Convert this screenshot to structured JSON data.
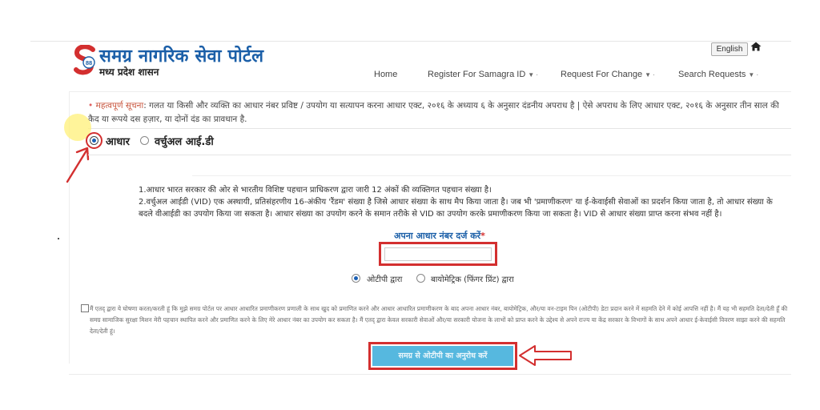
{
  "brand": {
    "title": "समग्र नागरिक सेवा पोर्टल",
    "subtitle": "मध्य प्रदेश शासन",
    "logo_badge": "88"
  },
  "header": {
    "language_button": "English",
    "home_icon": "home-icon"
  },
  "nav": {
    "home": "Home",
    "register": "Register For Samagra ID",
    "request": "Request For Change",
    "search": "Search Requests",
    "dropdown_icon": "caret-down-icon"
  },
  "notice": {
    "bullet": "•",
    "label": "महत्वपूर्ण सूचना",
    "text": ": गलत या किसी और व्यक्ति का आधार नंबर प्रविष्ट / उपयोग या सत्यापन करना आधार एक्ट, २०१६ के अध्याय ६ के अनुसार दंडनीय अपराध है | ऐसे अपराध के लिए आधार एक्ट, २०१६ के अनुसार तीन साल की कैद या रूपये दस हज़ार, या दोनों दंड का प्रावधान है."
  },
  "id_type": {
    "aadhaar": "आधार",
    "vid": "वर्चुअल आई.डी",
    "selected": "aadhaar"
  },
  "info": {
    "line1": "1.आधार भारत सरकार की ओर से भारतीय विशिष्ट पहचान प्राधिकरण द्वारा जारी 12 अंकों की व्यक्तिगत पहचान संख्या है।",
    "line2": "2.वर्चुअल आईडी (VID) एक अस्थायी, प्रतिसंहरणीय 16-अंकीय 'रैंडम' संख्या है जिसे आधार संख्या के साथ मैप किया जाता है। जब भी 'प्रमाणीकरण' या ई-केवाईसी सेवाओं का प्रदर्शन किया जाता है, तो आधार संख्या के बदले वीआईडी का उपयोग किया जा सकता है। आधार संख्या का उपयोग करने के समान तरीके से VID का उपयोग करके प्रमाणीकरण किया जा सकता है। VID से आधार संख्या प्राप्त करना संभव नहीं है।"
  },
  "aadhaar_input": {
    "label": "अपना आधार नंबर दर्ज करें",
    "required_mark": "*",
    "value": "",
    "placeholder": ""
  },
  "auth_mode": {
    "otp": "ओटीपी द्वारा",
    "biometric": "बायोमेट्रिक (फिंगर प्रिंट) द्वारा",
    "selected": "otp"
  },
  "consent": {
    "checked": false,
    "text": "मैं एतद् द्वारा ये घोषणा करता/करती हूं कि मुझे समग्र पोर्टल पर आधार आधारित प्रमाणीकरण प्रणाली के साथ खुद को प्रमाणित करने और आधार आधारित प्रमाणीकरण के बाद अपना आधार नंबर, बायोमेट्रिक, और/या वन-टाइम पिन (ओटीपी) डेटा प्रदान करने में सहमति देने में कोई आपत्ति नहीं है। मैं यह भी सहमति देता/देती हूँ की समग्र सामाजिक सुरक्षा मिशन मेरी पहचान स्थापित करने और प्रमाणित करने के लिए मेरे आधार नंबर का उपयोग कर सकता है। मैं एतद् द्वारा केवल सरकारी सेवाओं और/या सरकारी योजना के लाभों को प्राप्त करने के उद्देश्य से अपने राज्य या केंद्र सरकार के विभागों के साथ अपने आधार ई-केवाईसी विवरण साझा करने की सहमति देता/देती हूं।"
  },
  "submit": {
    "label": "समग्र से ओटीपी का अनुरोध करें"
  },
  "annotations": {
    "accent": "#d32f2f",
    "radio_arrow": "red-arrow-icon",
    "button_arrow": "red-outline-arrow-icon"
  },
  "colors": {
    "brand_blue": "#1b5fa8",
    "button": "#56b8df",
    "notice_label": "#c8553d",
    "highlight": "#fff078"
  }
}
